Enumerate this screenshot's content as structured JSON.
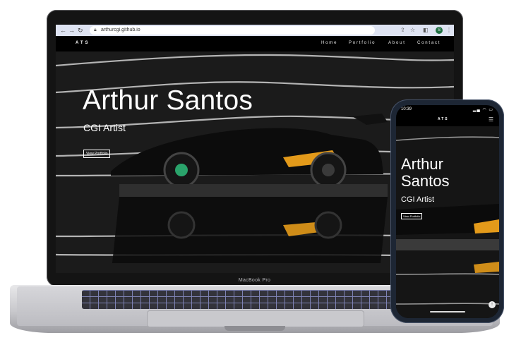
{
  "laptop": {
    "model_label": "MacBook Pro",
    "browser": {
      "back_icon": "back-arrow-icon",
      "forward_icon": "forward-arrow-icon",
      "reload_icon": "reload-icon",
      "url": "arthurcgi.github.io",
      "avatar_letter": "S"
    },
    "site": {
      "logo": "ATS",
      "menu": [
        "Home",
        "Portfolio",
        "About",
        "Contact"
      ],
      "hero_title": "Arthur Santos",
      "hero_subtitle": "CGI Artist",
      "hero_button": "View Portfolio"
    }
  },
  "phone": {
    "status_time": "10:39",
    "logo": "ATS",
    "hero_title": "Arthur Santos",
    "hero_subtitle": "CGI Artist",
    "hero_button": "View Portfolio",
    "menu_icon": "hamburger-icon",
    "scroll_icon": "scroll-up-icon"
  },
  "colors": {
    "accent_orange": "#e39a1a",
    "hero_background": "#1b1b1b",
    "phone_frame": "#1d2634"
  }
}
